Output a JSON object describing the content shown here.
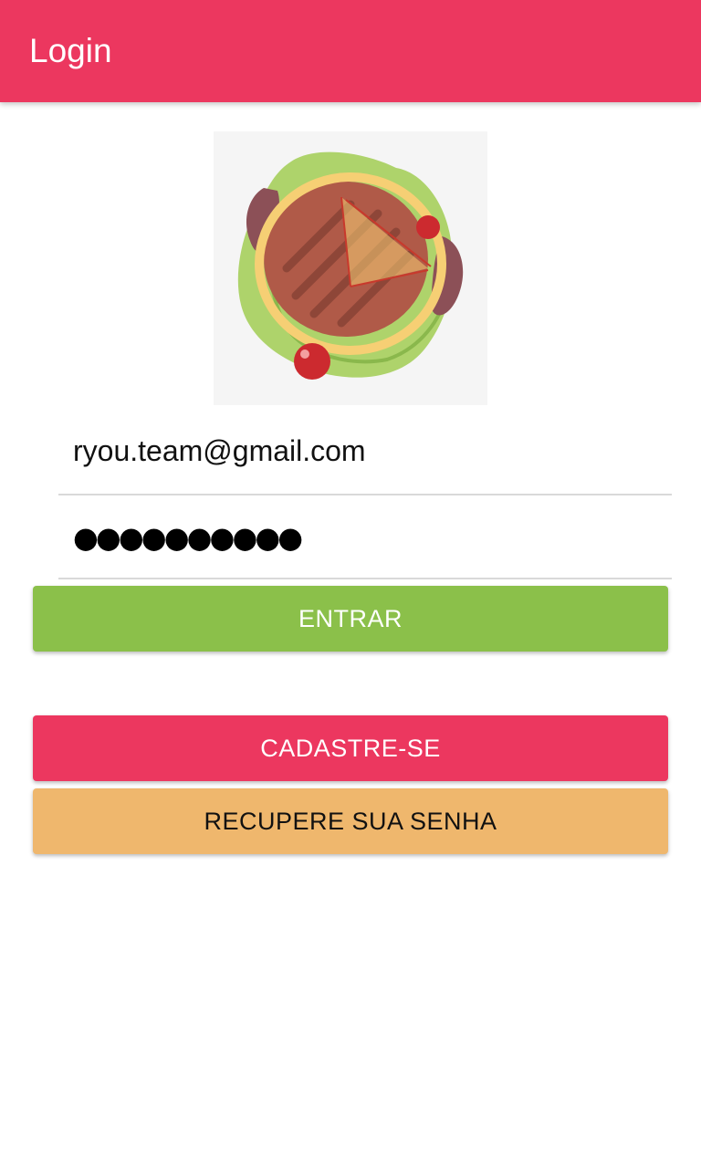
{
  "appbar": {
    "title": "Login"
  },
  "logo": {
    "icon": "burger-logo-icon"
  },
  "form": {
    "email_value": "ryou.team@gmail.com",
    "password_masked": "●●●●●●●●●●"
  },
  "buttons": {
    "entrar": "ENTRAR",
    "cadastre": "CADASTRE-SE",
    "recupere": "RECUPERE SUA SENHA"
  },
  "colors": {
    "primary": "#ec375f",
    "success": "#8bc04a",
    "accent": "#efb76d"
  }
}
